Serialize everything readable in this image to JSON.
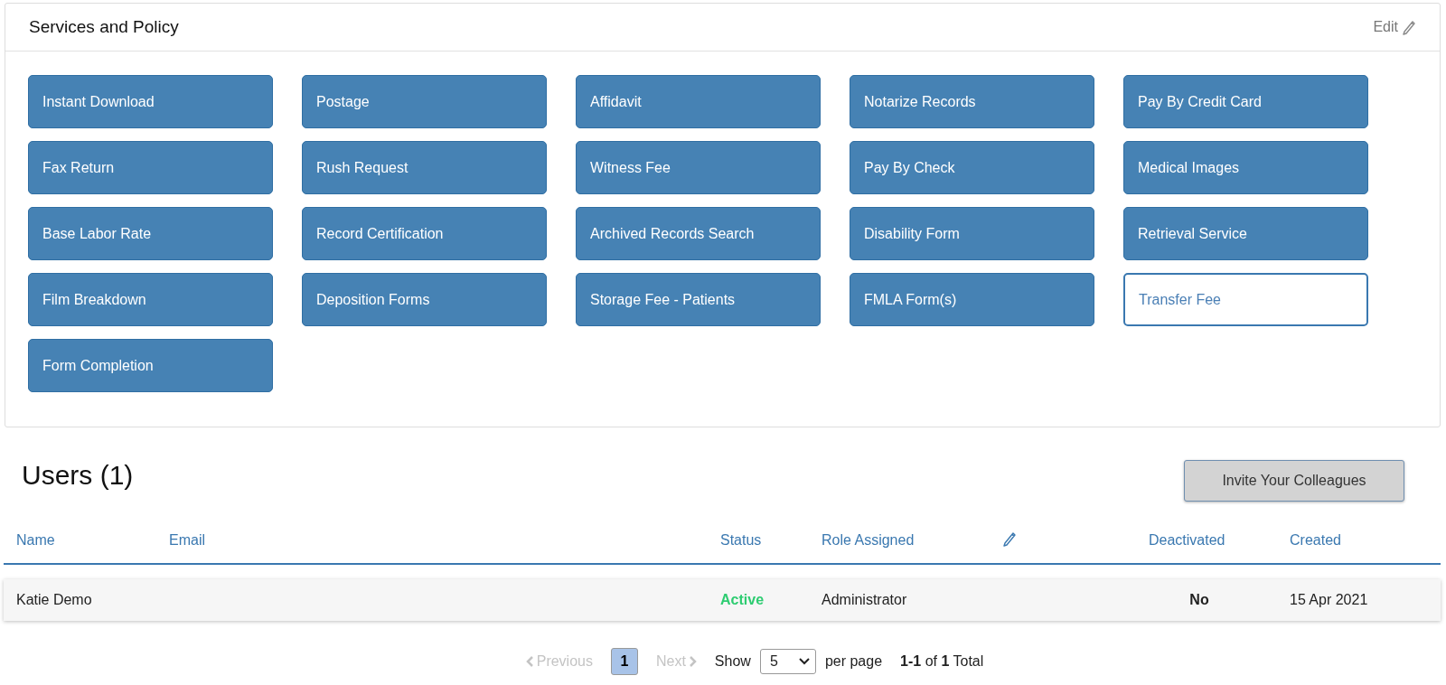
{
  "card": {
    "title": "Services and Policy",
    "edit_label": "Edit"
  },
  "services": [
    {
      "label": "Instant Download",
      "selected": true
    },
    {
      "label": "Postage",
      "selected": true
    },
    {
      "label": "Affidavit",
      "selected": true
    },
    {
      "label": "Notarize Records",
      "selected": true
    },
    {
      "label": "Pay By Credit Card",
      "selected": true
    },
    {
      "label": "Fax Return",
      "selected": true
    },
    {
      "label": "Rush Request",
      "selected": true
    },
    {
      "label": "Witness Fee",
      "selected": true
    },
    {
      "label": "Pay By Check",
      "selected": true
    },
    {
      "label": "Medical Images",
      "selected": true
    },
    {
      "label": "Base Labor Rate",
      "selected": true
    },
    {
      "label": "Record Certification",
      "selected": true
    },
    {
      "label": "Archived Records Search",
      "selected": true
    },
    {
      "label": "Disability Form",
      "selected": true
    },
    {
      "label": "Retrieval Service",
      "selected": true
    },
    {
      "label": "Film Breakdown",
      "selected": true
    },
    {
      "label": "Deposition Forms",
      "selected": true
    },
    {
      "label": "Storage Fee - Patients",
      "selected": true
    },
    {
      "label": "FMLA Form(s)",
      "selected": true
    },
    {
      "label": "Transfer Fee",
      "selected": false
    },
    {
      "label": "Form Completion",
      "selected": true
    }
  ],
  "users": {
    "title": "Users (1)",
    "invite_button": "Invite Your Colleagues",
    "columns": [
      {
        "kind": "text",
        "label": "Name"
      },
      {
        "kind": "text",
        "label": "Email"
      },
      {
        "kind": "text",
        "label": "Status"
      },
      {
        "kind": "text",
        "label": "Role Assigned"
      },
      {
        "kind": "icon"
      },
      {
        "kind": "text",
        "label": "Deactivated"
      },
      {
        "kind": "text",
        "label": "Created"
      }
    ],
    "rows": [
      {
        "name": "Katie Demo",
        "status": "Active",
        "role": "Administrator",
        "deactivated": "No",
        "created": "15 Apr 2021"
      }
    ]
  },
  "pagination": {
    "previous": {
      "label": "Previous",
      "disabled": true
    },
    "pages": [
      {
        "label": "1",
        "selected": true
      }
    ],
    "next": {
      "label": "Next",
      "disabled": true
    },
    "show_label": "Show",
    "page_size": "5",
    "per_page_label": "per page",
    "summary": "**1-1** of **1** Total"
  }
}
